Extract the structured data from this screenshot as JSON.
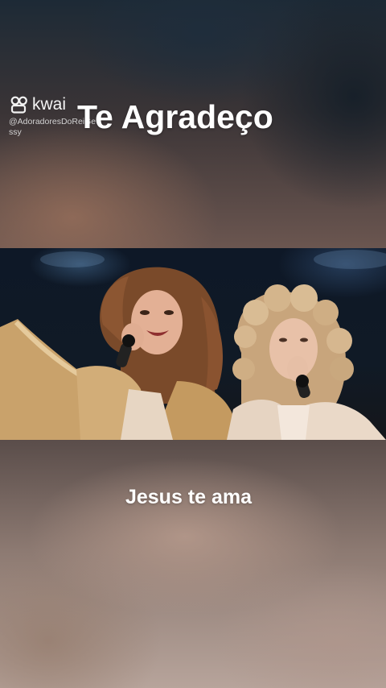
{
  "overlay": {
    "app_name": "kwai",
    "app_icon": "kwai-logo-icon",
    "user_handle": "@AdoradoresDoReiGessy",
    "title": "Te Agradeço"
  },
  "video": {
    "description_icon": "concert-video-frame"
  },
  "caption": {
    "text": "Jesus te ama"
  },
  "colors": {
    "title_text": "#ffffff",
    "suit_gold": "#c9a26b",
    "suit_cream": "#e9d9c7"
  }
}
